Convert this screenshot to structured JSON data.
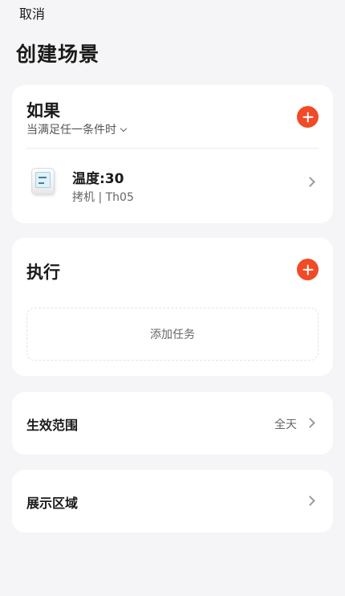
{
  "header": {
    "cancel_label": "取消",
    "title": "创建场景"
  },
  "if_section": {
    "title": "如果",
    "condition_mode": "当满足任一条件时",
    "conditions": [
      {
        "name": "温度:30",
        "device": "拷机 | Th05",
        "icon": "thermometer-hygrometer-icon"
      }
    ]
  },
  "do_section": {
    "title": "执行",
    "add_task_label": "添加任务"
  },
  "effective_range": {
    "label": "生效范围",
    "value": "全天"
  },
  "display_area": {
    "label": "展示区域"
  },
  "colors": {
    "accent": "#f04a26",
    "background": "#f5f5f7",
    "card": "#ffffff"
  }
}
